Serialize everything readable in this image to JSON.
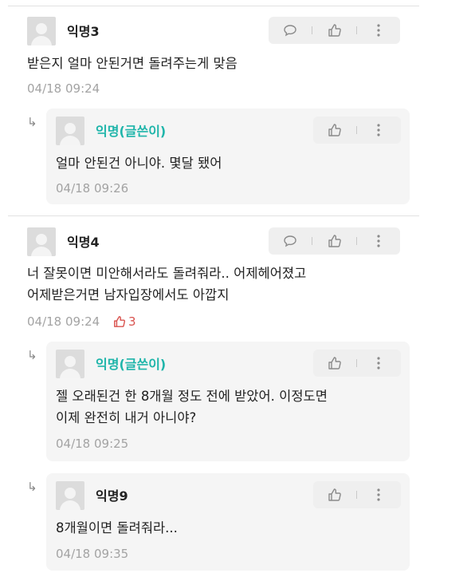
{
  "comments": [
    {
      "author": "익명3",
      "text": [
        "받은지 얼마 안된거면 돌려주는게 맞음"
      ],
      "time": "04/18 09:24",
      "actions": [
        "comment-icon",
        "thumbs-up-icon",
        "more-vertical-icon"
      ],
      "replies": [
        {
          "author": "익명(글쓴이)",
          "author_color": "#1fb5aa",
          "text": [
            "얼마 안된건 아니야. 몇달 됐어"
          ],
          "time": "04/18 09:26",
          "actions": [
            "thumbs-up-icon",
            "more-vertical-icon"
          ]
        }
      ]
    },
    {
      "author": "익명4",
      "text": [
        "너 잘못이면 미안해서라도 돌려줘라.. 어제헤어졌고",
        "어제받은거면 남자입장에서도 아깝지"
      ],
      "time": "04/18 09:24",
      "like_count": "3",
      "like_color": "#d9534f",
      "actions": [
        "comment-icon",
        "thumbs-up-icon",
        "more-vertical-icon"
      ],
      "replies": [
        {
          "author": "익명(글쓴이)",
          "author_color": "#1fb5aa",
          "text": [
            "젤 오래된건 한 8개월 정도 전에 받았어. 이정도면",
            "이제 완전히 내거 아니야?"
          ],
          "time": "04/18 09:25",
          "actions": [
            "thumbs-up-icon",
            "more-vertical-icon"
          ]
        },
        {
          "author": "익명9",
          "text": [
            "8개월이면 돌려줘라..."
          ],
          "time": "04/18 09:35",
          "actions": [
            "thumbs-up-icon",
            "more-vertical-icon"
          ]
        }
      ]
    }
  ]
}
